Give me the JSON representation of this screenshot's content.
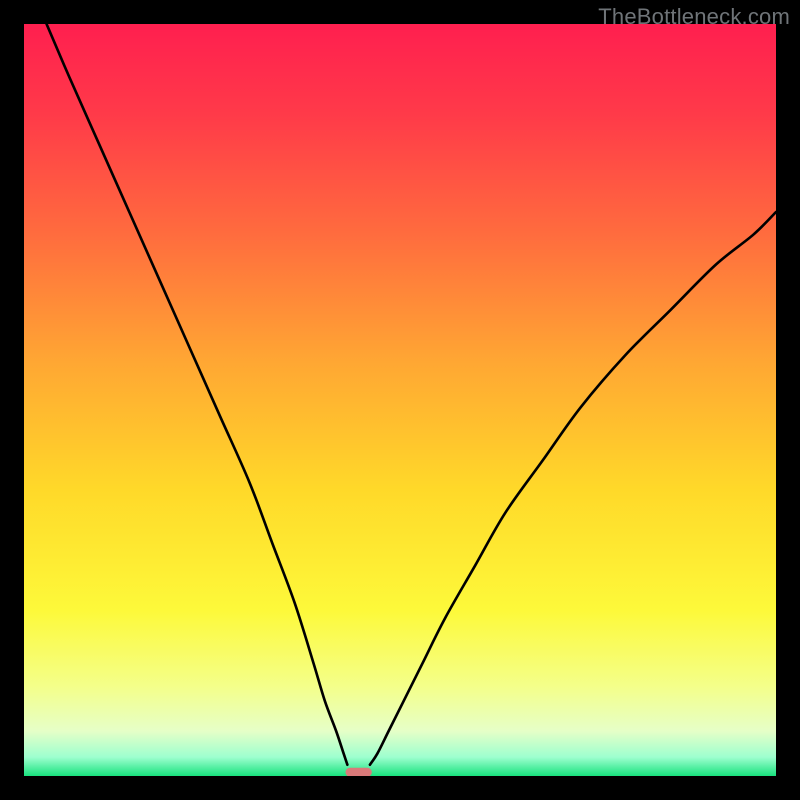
{
  "watermark": "TheBottleneck.com",
  "chart_data": {
    "type": "line",
    "title": "",
    "xlabel": "",
    "ylabel": "",
    "xlim": [
      0,
      100
    ],
    "ylim": [
      0,
      100
    ],
    "grid": false,
    "legend": false,
    "background_gradient": {
      "stops": [
        {
          "pos": 0.0,
          "color": "#ff1f4f"
        },
        {
          "pos": 0.12,
          "color": "#ff3a49"
        },
        {
          "pos": 0.28,
          "color": "#ff6c3e"
        },
        {
          "pos": 0.45,
          "color": "#ffa733"
        },
        {
          "pos": 0.62,
          "color": "#ffd929"
        },
        {
          "pos": 0.78,
          "color": "#fdf93a"
        },
        {
          "pos": 0.88,
          "color": "#f4ff89"
        },
        {
          "pos": 0.94,
          "color": "#e6ffc7"
        },
        {
          "pos": 0.975,
          "color": "#9dffcf"
        },
        {
          "pos": 1.0,
          "color": "#18e27e"
        }
      ]
    },
    "series": [
      {
        "name": "left-branch",
        "x": [
          3,
          6,
          10,
          14,
          18,
          22,
          26,
          30,
          33,
          36,
          38.5,
          40,
          41.5,
          42.5,
          43
        ],
        "y": [
          100,
          93,
          84,
          75,
          66,
          57,
          48,
          39,
          31,
          23,
          15,
          10,
          6,
          3,
          1.5
        ]
      },
      {
        "name": "right-branch",
        "x": [
          46,
          47,
          48.5,
          50.5,
          53,
          56,
          60,
          64,
          69,
          74,
          80,
          86,
          92,
          97,
          100
        ],
        "y": [
          1.5,
          3,
          6,
          10,
          15,
          21,
          28,
          35,
          42,
          49,
          56,
          62,
          68,
          72,
          75
        ]
      }
    ],
    "marker": {
      "name": "min-marker",
      "x": 44.5,
      "y": 0.5,
      "width": 3.5,
      "height": 1.2,
      "color": "#d97a7a"
    }
  }
}
